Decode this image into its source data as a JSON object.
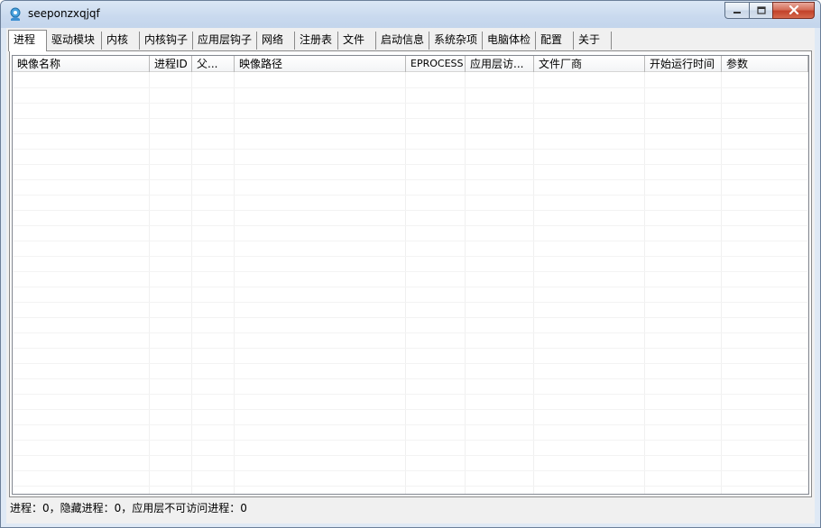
{
  "window": {
    "title": "seeponzxqjqf",
    "icon": "app-icon",
    "controls": [
      "minimize-icon",
      "maximize-icon",
      "close-icon"
    ]
  },
  "tabs": [
    {
      "label": "进程",
      "active": true
    },
    {
      "label": "驱动模块"
    },
    {
      "label": "内核"
    },
    {
      "label": "内核钩子"
    },
    {
      "label": "应用层钩子"
    },
    {
      "label": "网络"
    },
    {
      "label": "注册表"
    },
    {
      "label": "文件"
    },
    {
      "label": "启动信息"
    },
    {
      "label": "系统杂项"
    },
    {
      "label": "电脑体检"
    },
    {
      "label": "配置"
    },
    {
      "label": "关于"
    }
  ],
  "table": {
    "columns": [
      {
        "label": "映像名称"
      },
      {
        "label": "进程ID"
      },
      {
        "label": "父..."
      },
      {
        "label": "映像路径"
      },
      {
        "label": "EPROCESS"
      },
      {
        "label": "应用层访..."
      },
      {
        "label": "文件厂商"
      },
      {
        "label": "开始运行时间"
      },
      {
        "label": "参数"
      }
    ],
    "rows": []
  },
  "status": {
    "text": "进程：0，隐藏进程：0，应用层不可访问进程：0"
  }
}
